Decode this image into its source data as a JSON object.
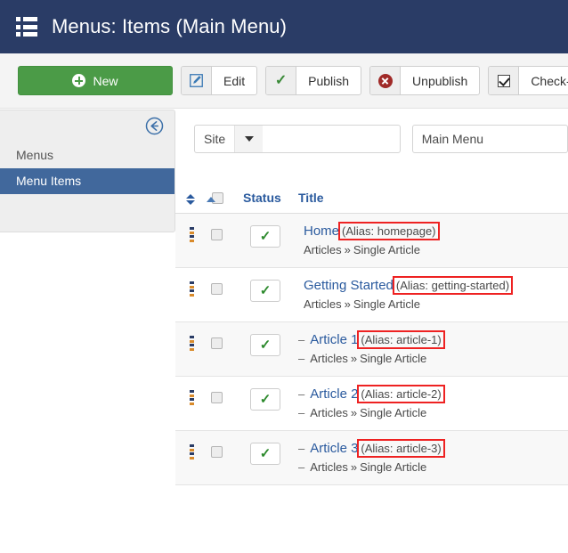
{
  "header": {
    "icon": "list-icon",
    "title": "Menus: Items (Main Menu)",
    "bg_color": "#2a3c66"
  },
  "toolbar": {
    "new_label": "New",
    "new_icon": "plus-circle-icon",
    "new_color": "#4b9b47",
    "buttons": [
      {
        "label": "Edit",
        "icon": "edit-pencil-icon"
      },
      {
        "label": "Publish",
        "icon": "check-icon"
      },
      {
        "label": "Unpublish",
        "icon": "x-circle-icon"
      },
      {
        "label": "Check-",
        "icon": "checkbox-icon"
      }
    ]
  },
  "sidebar": {
    "collapse_icon": "arrow-left-circle-icon",
    "items": [
      {
        "label": "Menus",
        "active": false
      },
      {
        "label": "Menu Items",
        "active": true
      }
    ],
    "active_color": "#41689c"
  },
  "filters": {
    "site": {
      "value": "Site",
      "caret": "chevron-down-icon"
    },
    "menu": {
      "value": "Main Menu"
    }
  },
  "table": {
    "headers": {
      "ordering_icon": "sort-updown-icon",
      "order_asc_icon": "sort-asc-icon",
      "select_all": "select-all-checkbox",
      "status": "Status",
      "title": "Title"
    },
    "rows": [
      {
        "handle": "drag-handle-icon",
        "status_icon": "published-check-icon",
        "indent": "",
        "title": "Home",
        "alias": "(Alias: homepage)",
        "alias_highlighted": true,
        "path_indent": "",
        "path_parent": "Articles",
        "path_separator": "»",
        "path_child": "Single Article"
      },
      {
        "handle": "drag-handle-icon",
        "status_icon": "published-check-icon",
        "indent": "",
        "title": "Getting Started",
        "alias": "(Alias: getting-started)",
        "alias_highlighted": true,
        "path_indent": "",
        "path_parent": "Articles",
        "path_separator": "»",
        "path_child": "Single Article"
      },
      {
        "handle": "drag-handle-icon",
        "status_icon": "published-check-icon",
        "indent": "–",
        "title": "Article 1",
        "alias": "(Alias: article-1)",
        "alias_highlighted": true,
        "path_indent": "–",
        "path_parent": "Articles",
        "path_separator": "»",
        "path_child": "Single Article"
      },
      {
        "handle": "drag-handle-icon",
        "status_icon": "published-check-icon",
        "indent": "–",
        "title": "Article 2",
        "alias": "(Alias: article-2)",
        "alias_highlighted": true,
        "path_indent": "–",
        "path_parent": "Articles",
        "path_separator": "»",
        "path_child": "Single Article"
      },
      {
        "handle": "drag-handle-icon",
        "status_icon": "published-check-icon",
        "indent": "–",
        "title": "Article 3",
        "alias": "(Alias: article-3)",
        "alias_highlighted": true,
        "path_indent": "–",
        "path_parent": "Articles",
        "path_separator": "»",
        "path_child": "Single Article"
      }
    ]
  },
  "annotation": {
    "highlight_color": "#ee2222"
  }
}
